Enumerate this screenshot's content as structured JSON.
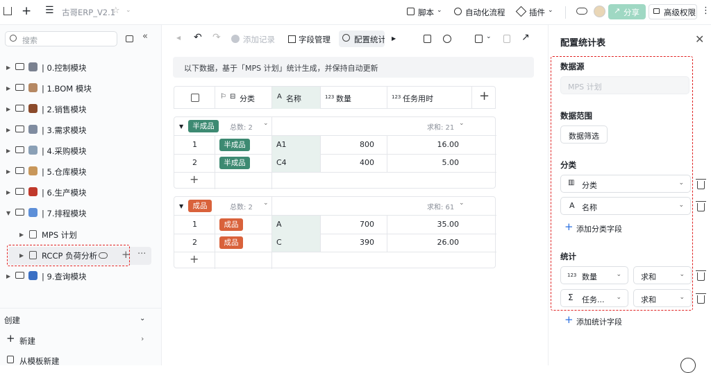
{
  "app": {
    "title": "古哥ERP_V2.1"
  },
  "topbar": {
    "script": "脚本",
    "automation": "自动化流程",
    "plugins": "插件",
    "share": "分享",
    "permissions": "高级权限"
  },
  "sidebar": {
    "search_placeholder": "搜索",
    "items": [
      {
        "label": "| 0.控制模块",
        "icon": "gear-icon",
        "color": "#7a8190"
      },
      {
        "label": "| 1.BOM 模块",
        "icon": "clipboard-icon",
        "color": "#b58863"
      },
      {
        "label": "| 2.销售模块",
        "icon": "briefcase-icon",
        "color": "#8b4a2b"
      },
      {
        "label": "| 3.需求模块",
        "icon": "calendar-icon",
        "color": "#7f8ca0"
      },
      {
        "label": "| 4.采购模块",
        "icon": "cart-icon",
        "color": "#8aa0b6"
      },
      {
        "label": "| 5.仓库模块",
        "icon": "box-icon",
        "color": "#c8975a"
      },
      {
        "label": "| 6.生产模块",
        "icon": "book-icon",
        "color": "#c0392b"
      },
      {
        "label": "| 7.排程模块",
        "icon": "calendar-icon",
        "color": "#5d8fd8"
      },
      {
        "label": "| 9.查询模块",
        "icon": "magnifier-icon",
        "color": "#3a6fc4"
      }
    ],
    "subitems": [
      {
        "label": "MPS 计划"
      },
      {
        "label": "RCCP 负荷分析"
      }
    ],
    "create_label": "创建",
    "new_label": "新建",
    "template_label": "从模板新建"
  },
  "toolbar": {
    "add_record": "添加记录",
    "field_manage": "字段管理",
    "config_stats": "配置统计"
  },
  "notice": "以下数据，基于「MPS 计划」统计生成，并保持自动更新",
  "table": {
    "headers": [
      "分类",
      "名称",
      "数量",
      "任务用时"
    ],
    "groups": [
      {
        "tag": "半成品",
        "count_label": "总数: 2",
        "sum_label": "求和: 21",
        "rows": [
          {
            "n": "1",
            "cat": "半成品",
            "name": "A1",
            "qty": "800",
            "time": "16.00"
          },
          {
            "n": "2",
            "cat": "半成品",
            "name": "C4",
            "qty": "400",
            "time": "5.00"
          }
        ]
      },
      {
        "tag": "成品",
        "count_label": "总数: 2",
        "sum_label": "求和: 61",
        "rows": [
          {
            "n": "1",
            "cat": "成品",
            "name": "A",
            "qty": "700",
            "time": "35.00"
          },
          {
            "n": "2",
            "cat": "成品",
            "name": "C",
            "qty": "390",
            "time": "26.00"
          }
        ]
      }
    ]
  },
  "panel": {
    "title": "配置统计表",
    "source_title": "数据源",
    "source_value": "MPS 计划",
    "range_title": "数据范围",
    "range_button": "数据筛选",
    "group_title": "分类",
    "group_fields": [
      "分类",
      "名称"
    ],
    "add_group": "添加分类字段",
    "stats_title": "统计",
    "stats_fields": [
      {
        "field": "数量",
        "agg": "求和"
      },
      {
        "field": "任务...",
        "agg": "求和"
      }
    ],
    "add_stat": "添加统计字段"
  }
}
